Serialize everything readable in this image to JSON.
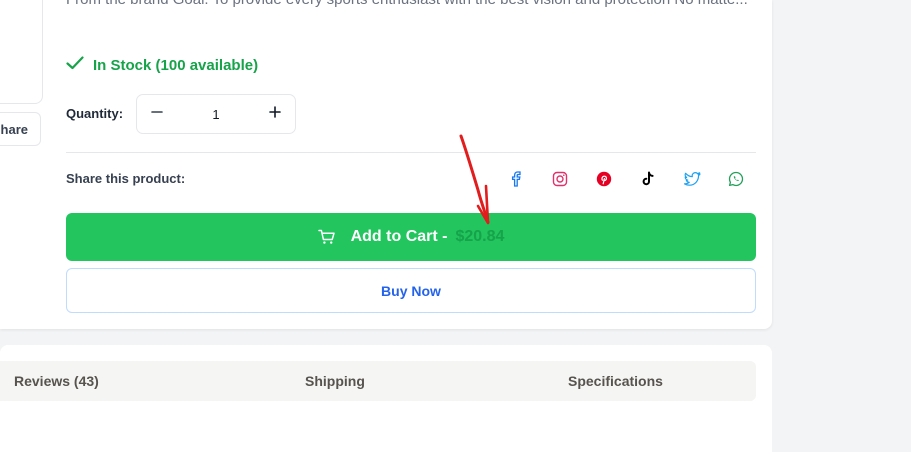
{
  "product": {
    "description": "From the brand Goal. To provide every sports enthusiast with the best vision and protection No matte...",
    "stock_text": "In Stock (100 available)",
    "quantity_label": "Quantity:",
    "quantity_value": "1",
    "share_label": "Share this product:",
    "side_share_label": "hare"
  },
  "social": [
    {
      "icon": "facebook-icon",
      "color": "#1877f2"
    },
    {
      "icon": "instagram-icon",
      "color": "#e1306c"
    },
    {
      "icon": "pinterest-icon",
      "color": "#e60023"
    },
    {
      "icon": "tiktok-icon",
      "color": "#000000"
    },
    {
      "icon": "twitter-icon",
      "color": "#1da1f2"
    },
    {
      "icon": "whatsapp-icon",
      "color": "#25d366"
    }
  ],
  "actions": {
    "add_to_cart_label": "Add to Cart -",
    "price": "$20.84",
    "buy_now_label": "Buy Now"
  },
  "tabs": [
    {
      "label": "Reviews (43)"
    },
    {
      "label": "Shipping"
    },
    {
      "label": "Specifications"
    }
  ],
  "colors": {
    "accent_green": "#22c55e",
    "stock_green": "#16a34a",
    "buy_blue": "#2563eb",
    "annotation_red": "#e11d1d"
  }
}
